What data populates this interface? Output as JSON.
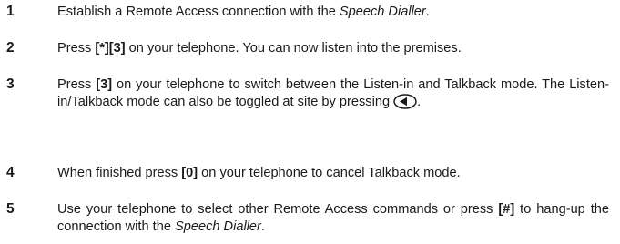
{
  "steps": [
    {
      "number": "1",
      "text_before": "Establish a Remote Access connection with the ",
      "text_italic": "Speech Dialler",
      "text_after": "."
    },
    {
      "number": "2",
      "text_before": "Press ",
      "key": "[*][3]",
      "text_after": " on your telephone. You can now listen into the premises."
    },
    {
      "number": "3",
      "text_before": "Press ",
      "key": "[3]",
      "text_middle": " on your telephone to switch between the Listen-in and Talkback mode. The Listen-in/Talkback mode can also be toggled at site by pressing ",
      "icon": "left-arrow-key-icon",
      "text_after": "."
    },
    {
      "number": "4",
      "text_before": "When finished press ",
      "key": "[0]",
      "text_after": " on your telephone to cancel Talkback mode."
    },
    {
      "number": "5",
      "text_before": "Use your telephone to select other Remote Access commands or press ",
      "key": "[#]",
      "text_middle": " to hang-up the connection with the ",
      "text_italic": "Speech Dialler",
      "text_after": "."
    }
  ]
}
